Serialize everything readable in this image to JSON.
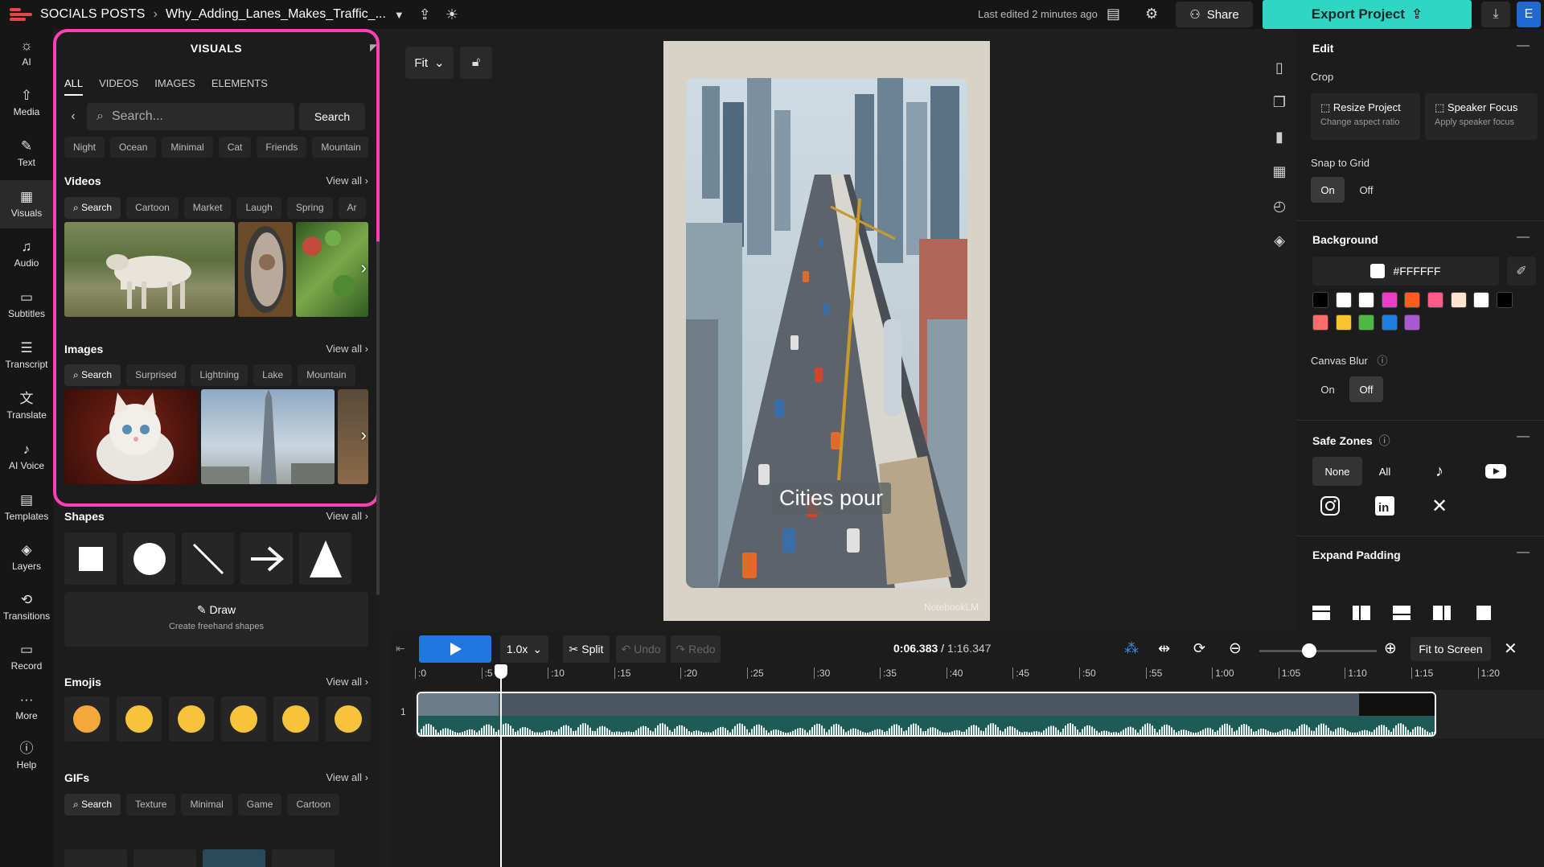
{
  "topbar": {
    "breadcrumb": "SOCIALS POSTS",
    "project_name": "Why_Adding_Lanes_Makes_Traffic_...",
    "last_edited": "Last edited 2 minutes ago",
    "share_label": "Share",
    "export_label": "Export Project",
    "avatar_letter": "E"
  },
  "leftnav": {
    "items": [
      {
        "label": "AI",
        "icon": "sparkle-icon"
      },
      {
        "label": "Media",
        "icon": "upload-icon"
      },
      {
        "label": "Text",
        "icon": "text-icon"
      },
      {
        "label": "Visuals",
        "icon": "visuals-icon"
      },
      {
        "label": "Audio",
        "icon": "music-icon"
      },
      {
        "label": "Subtitles",
        "icon": "subtitles-icon"
      },
      {
        "label": "Transcript",
        "icon": "transcript-icon"
      },
      {
        "label": "Translate",
        "icon": "translate-icon"
      },
      {
        "label": "AI Voice",
        "icon": "microphone-icon"
      },
      {
        "label": "Templates",
        "icon": "templates-icon"
      },
      {
        "label": "Layers",
        "icon": "layers-icon"
      },
      {
        "label": "Transitions",
        "icon": "transitions-icon"
      },
      {
        "label": "Record",
        "icon": "record-icon"
      },
      {
        "label": "More",
        "icon": "more-icon"
      },
      {
        "label": "Help",
        "icon": "help-icon"
      }
    ]
  },
  "visuals": {
    "title": "VISUALS",
    "tabs": [
      "ALL",
      "VIDEOS",
      "IMAGES",
      "ELEMENTS"
    ],
    "search_placeholder": "Search...",
    "search_button": "Search",
    "chips": [
      "Night",
      "Ocean",
      "Minimal",
      "Cat",
      "Friends",
      "Mountain"
    ],
    "view_all": "View all",
    "videos": {
      "title": "Videos",
      "chips": [
        "Search",
        "Cartoon",
        "Market",
        "Laugh",
        "Spring",
        "Ar"
      ]
    },
    "images": {
      "title": "Images",
      "chips": [
        "Search",
        "Surprised",
        "Lightning",
        "Lake",
        "Mountain"
      ]
    },
    "shapes": {
      "title": "Shapes",
      "draw_label": "Draw",
      "draw_sub": "Create freehand shapes"
    },
    "emojis": {
      "title": "Emojis"
    },
    "gifs": {
      "title": "GIFs",
      "chips": [
        "Search",
        "Texture",
        "Minimal",
        "Game",
        "Cartoon",
        ""
      ]
    }
  },
  "canvas": {
    "fit_label": "Fit",
    "caption": "Cities pour",
    "watermark": "NotebookLM"
  },
  "edit_panel": {
    "edit_title": "Edit",
    "crop_label": "Crop",
    "resize_title": "Resize Project",
    "resize_sub": "Change aspect ratio",
    "speaker_title": "Speaker Focus",
    "speaker_sub": "Apply speaker focus",
    "snap_label": "Snap to Grid",
    "on": "On",
    "off": "Off",
    "background_title": "Background",
    "hex": "#FFFFFF",
    "swatches": [
      "#000000",
      "#ffffff",
      "#ffffff",
      "#e83ec8",
      "#ff5a1f",
      "#ff5a8a",
      "#ffe3cc",
      "#ffffff",
      "#000000",
      "#ff6b6b",
      "#f7c52b",
      "#4cb944",
      "#1e7ee0",
      "#a85ad1"
    ],
    "canvas_blur_label": "Canvas Blur",
    "safe_zones_title": "Safe Zones",
    "none": "None",
    "all": "All",
    "expand_padding_title": "Expand Padding"
  },
  "timeline": {
    "speed": "1.0x",
    "split": "Split",
    "undo": "Undo",
    "redo": "Redo",
    "current_time": "0:06.383",
    "total_time": "1:16.347",
    "fit_to_screen": "Fit to Screen",
    "track_number": "1",
    "ticks": [
      ":0",
      ":5",
      ":10",
      ":15",
      ":20",
      ":25",
      ":30",
      ":35",
      ":40",
      ":45",
      ":50",
      ":55",
      "1:00",
      "1:05",
      "1:10",
      "1:15",
      "1:20"
    ]
  },
  "colors": {
    "accent": "#2fd6c3",
    "highlight": "#ff3fb4",
    "play": "#1e78e0"
  }
}
